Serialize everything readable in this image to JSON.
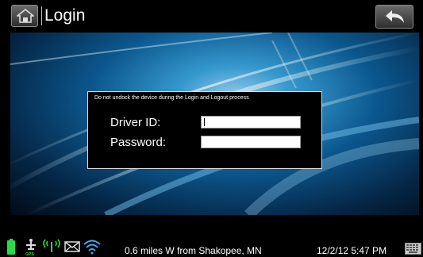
{
  "header": {
    "title": "Login",
    "home_icon": "home-icon",
    "back_icon": "back-arrow-icon"
  },
  "dialog": {
    "notice": "Do not undock the device during the Login and Logout process",
    "driver_id_label": "Driver ID:",
    "driver_id_value": "",
    "password_label": "Password:",
    "password_value": ""
  },
  "status_bar": {
    "icons": [
      "battery-icon",
      "gps-icon",
      "cellular-signal-icon",
      "message-envelope-icon",
      "wifi-icon",
      "keyboard-icon"
    ],
    "gps_label": "GPS",
    "location": "0.6 miles W from Shakopee, MN",
    "datetime": "12/2/12 5:47 PM"
  },
  "colors": {
    "status_green": "#2bd94b",
    "wifi_blue": "#3fa9f5",
    "background_blue": "#0d5f9a"
  }
}
